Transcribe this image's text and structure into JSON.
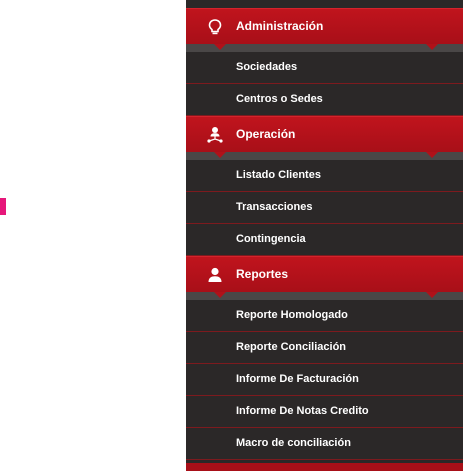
{
  "colors": {
    "section_red": "#b01119",
    "item_background": "#2b2828",
    "separator_gray": "#4a4747",
    "marker_pink": "#e6177a"
  },
  "menu": {
    "sections": [
      {
        "label": "Administración",
        "icon": "lightbulb-icon",
        "items": [
          "Sociedades",
          "Centros o Sedes"
        ]
      },
      {
        "label": "Operación",
        "icon": "user-network-icon",
        "items": [
          "Listado Clientes",
          "Transacciones",
          "Contingencia"
        ]
      },
      {
        "label": "Reportes",
        "icon": "user-icon",
        "items": [
          "Reporte Homologado",
          "Reporte Conciliación",
          "Informe De Facturación",
          "Informe De Notas Credito",
          "Macro de conciliación"
        ]
      }
    ]
  }
}
